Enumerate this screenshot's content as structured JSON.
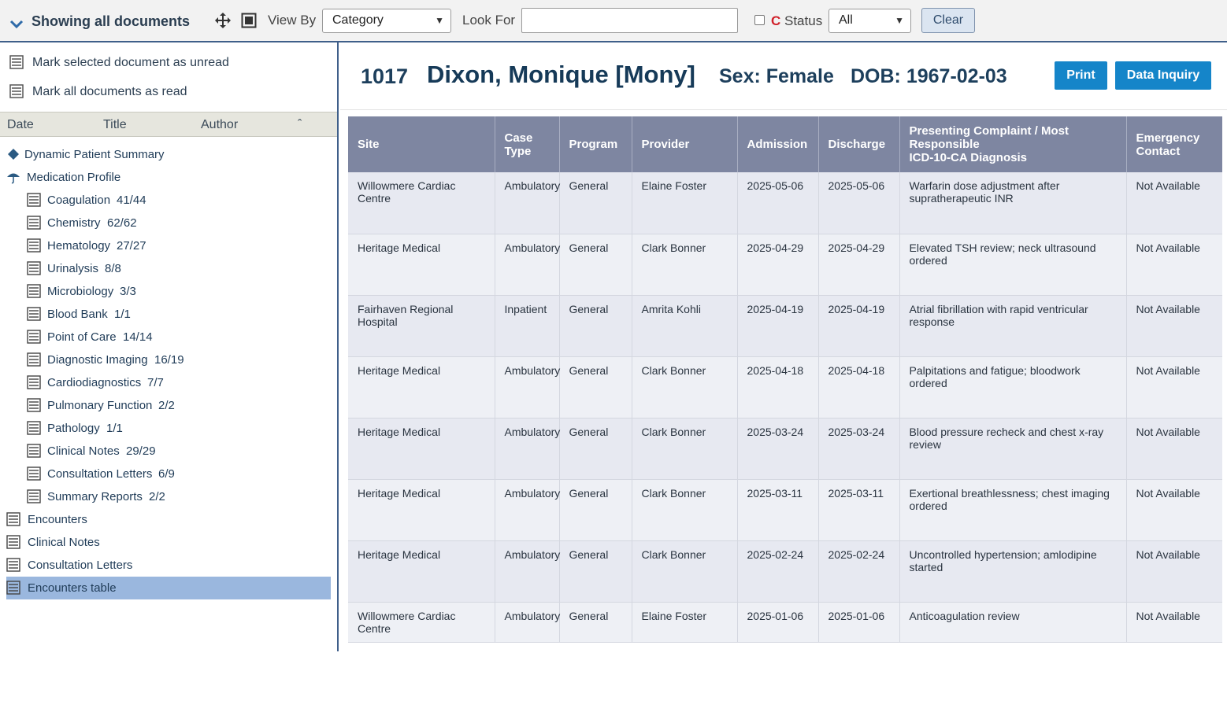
{
  "toolbar": {
    "showing_label": "Showing all documents",
    "view_by_label": "View By",
    "view_by_value": "Category",
    "look_for_label": "Look For",
    "look_for_value": "",
    "c_label": "C",
    "status_label": "Status",
    "status_value": "All",
    "clear_label": "Clear"
  },
  "sidebar": {
    "actions": {
      "mark_unread": "Mark selected document as unread",
      "mark_all_read": "Mark all documents as read"
    },
    "columns": {
      "date": "Date",
      "title": "Title",
      "author": "Author",
      "sort_icon": "ˆ"
    },
    "tree": [
      {
        "label": "Dynamic Patient Summary",
        "count": "",
        "icon": "diamond-icon",
        "level": 0
      },
      {
        "label": "Medication Profile",
        "count": "",
        "icon": "umbrella-icon",
        "level": 0
      },
      {
        "label": "Coagulation",
        "count": "41/44",
        "icon": "document-icon",
        "level": 1
      },
      {
        "label": "Chemistry",
        "count": "62/62",
        "icon": "document-icon",
        "level": 1
      },
      {
        "label": "Hematology",
        "count": "27/27",
        "icon": "document-icon",
        "level": 1
      },
      {
        "label": "Urinalysis",
        "count": "8/8",
        "icon": "document-icon",
        "level": 1
      },
      {
        "label": "Microbiology",
        "count": "3/3",
        "icon": "document-icon",
        "level": 1
      },
      {
        "label": "Blood Bank",
        "count": "1/1",
        "icon": "document-icon",
        "level": 1
      },
      {
        "label": "Point of Care",
        "count": "14/14",
        "icon": "document-icon",
        "level": 1
      },
      {
        "label": "Diagnostic Imaging",
        "count": "16/19",
        "icon": "document-icon",
        "level": 1
      },
      {
        "label": "Cardiodiagnostics",
        "count": "7/7",
        "icon": "document-icon",
        "level": 1
      },
      {
        "label": "Pulmonary Function",
        "count": "2/2",
        "icon": "document-icon",
        "level": 1
      },
      {
        "label": "Pathology",
        "count": "1/1",
        "icon": "document-icon",
        "level": 1
      },
      {
        "label": "Clinical Notes",
        "count": "29/29",
        "icon": "document-icon",
        "level": 1
      },
      {
        "label": "Consultation Letters",
        "count": "6/9",
        "icon": "document-icon",
        "level": 1
      },
      {
        "label": "Summary Reports",
        "count": "2/2",
        "icon": "document-icon",
        "level": 1
      },
      {
        "label": "Encounters",
        "count": "",
        "icon": "document-icon",
        "level": 0
      },
      {
        "label": "Clinical Notes",
        "count": "",
        "icon": "document-icon",
        "level": 0
      },
      {
        "label": "Consultation Letters",
        "count": "",
        "icon": "document-icon",
        "level": 0
      },
      {
        "label": "Encounters table",
        "count": "",
        "icon": "document-icon",
        "level": 0,
        "selected": true
      }
    ]
  },
  "patient": {
    "id": "1017",
    "name": "Dixon, Monique [Mony]",
    "sex": "Sex: Female",
    "dob": "DOB: 1967-02-03"
  },
  "buttons": {
    "print": "Print",
    "data_inquiry": "Data Inquiry"
  },
  "encounters": {
    "headers": [
      "Site",
      "Case\nType",
      "Program",
      "Provider",
      "Admission",
      "Discharge",
      "Presenting Complaint / Most\nResponsible\nICD-10-CA Diagnosis",
      "Emergency\nContact"
    ],
    "rows": [
      [
        "Willowmere Cardiac\nCentre",
        "Ambulatory",
        "General",
        "Elaine Foster",
        "2025-05-06",
        "2025-05-06",
        "Warfarin dose adjustment after\nsupratherapeutic INR",
        "Not Available"
      ],
      [
        "Heritage Medical",
        "Ambulatory",
        "General",
        "Clark Bonner",
        "2025-04-29",
        "2025-04-29",
        "Elevated TSH review; neck ultrasound\nordered",
        "Not Available"
      ],
      [
        "Fairhaven Regional\nHospital",
        "Inpatient",
        "General",
        "Amrita Kohli",
        "2025-04-19",
        "2025-04-19",
        "Atrial fibrillation with rapid ventricular\nresponse",
        "Not Available"
      ],
      [
        "Heritage Medical",
        "Ambulatory",
        "General",
        "Clark Bonner",
        "2025-04-18",
        "2025-04-18",
        "Palpitations and fatigue; bloodwork\nordered",
        "Not Available"
      ],
      [
        "Heritage Medical",
        "Ambulatory",
        "General",
        "Clark Bonner",
        "2025-03-24",
        "2025-03-24",
        "Blood pressure recheck and chest x-ray\nreview",
        "Not Available"
      ],
      [
        "Heritage Medical",
        "Ambulatory",
        "General",
        "Clark Bonner",
        "2025-03-11",
        "2025-03-11",
        "Exertional breathlessness; chest imaging\nordered",
        "Not Available"
      ],
      [
        "Heritage Medical",
        "Ambulatory",
        "General",
        "Clark Bonner",
        "2025-02-24",
        "2025-02-24",
        "Uncontrolled hypertension; amlodipine\nstarted",
        "Not Available"
      ],
      [
        "Willowmere Cardiac\nCentre",
        "Ambulatory",
        "General",
        "Elaine Foster",
        "2025-01-06",
        "2025-01-06",
        "Anticoagulation review",
        "Not Available"
      ]
    ]
  },
  "colors": {
    "accent_blue": "#1585c9",
    "header_navy": "#163a58",
    "table_header": "#7e86a1",
    "selected_row": "#9ab7de",
    "c_red": "#d0202a"
  }
}
